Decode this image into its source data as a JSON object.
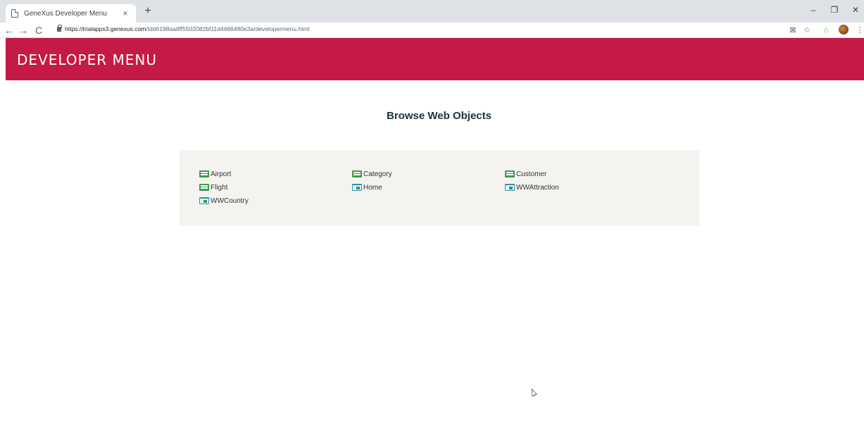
{
  "browser": {
    "tab_title": "GeneXus Developer Menu",
    "tab_close": "×",
    "new_tab": "+",
    "url_host": "https://trialapps3.genexus.com",
    "url_path": "/Idd6198aa8ff5502082bf11d4466480e3a/developermenu.html",
    "nav": {
      "back": "←",
      "forward": "→",
      "reload": "C"
    },
    "window_controls": {
      "minimize": "–",
      "restore": "❐",
      "close": "✕"
    },
    "toolbar_icons": {
      "translate": "⊠",
      "bookmark": "☆",
      "extension": "⌂",
      "menu": "⋮"
    }
  },
  "header": {
    "title": "DEVELOPER MENU",
    "brand_color": "#c41a45"
  },
  "main": {
    "section_title": "Browse Web Objects",
    "objects": [
      {
        "label": "Airport",
        "icon": "transaction-icon"
      },
      {
        "label": "Category",
        "icon": "transaction-icon"
      },
      {
        "label": "Customer",
        "icon": "transaction-icon"
      },
      {
        "label": "Flight",
        "icon": "transaction-icon"
      },
      {
        "label": "Home",
        "icon": "webpanel-icon"
      },
      {
        "label": "WWAttraction",
        "icon": "webpanel-icon"
      },
      {
        "label": "WWCountry",
        "icon": "webpanel-icon"
      }
    ]
  }
}
